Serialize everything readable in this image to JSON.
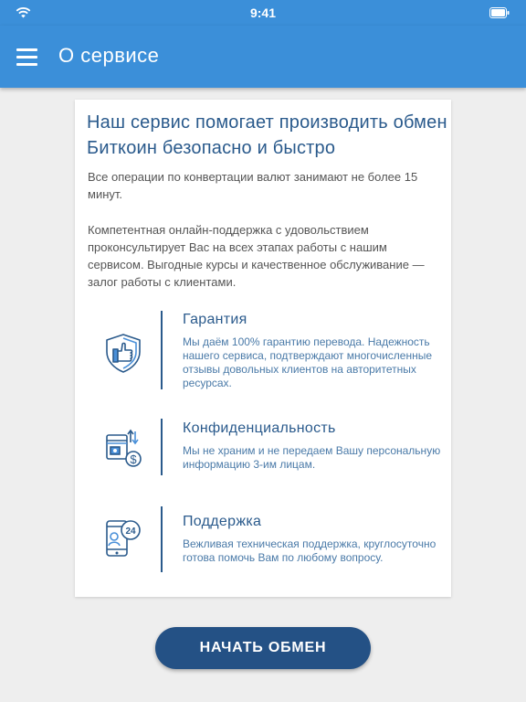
{
  "status_bar": {
    "time": "9:41"
  },
  "app_bar": {
    "title": "О сервисе",
    "menu_icon": "hamburger-menu-icon"
  },
  "card": {
    "headline": "Наш сервис помогает производить обмен Биткоин безопасно и быстро",
    "paragraph_1": "Все операции по конвертации валют занимают не более 15 минут.",
    "paragraph_2": "Компетентная онлайн-поддержка с удовольствием проконсультирует Вас на всех этапах работы с нашим сервисом. Выгодные курсы и качественное обслуживание — залог работы с клиентами.",
    "features": [
      {
        "title": "Гарантия",
        "description": "Мы даём 100% гарантию перевода. Надежность нашего сервиса, подтверждают многочисленные отзывы довольных клиентов на авторитетных ресурсах.",
        "icon": "shield-thumbs-up-icon"
      },
      {
        "title": "Конфиденциальность",
        "description": "Мы не храним и не передаем Вашу персональную информацию 3-им лицам.",
        "icon": "secure-payment-icon"
      },
      {
        "title": "Поддержка",
        "description": "Вежливая техническая поддержка, круглосуточно готова помочь Вам по любому вопросу.",
        "icon": "phone-support-24-icon"
      }
    ]
  },
  "cta_button": {
    "label": "НАЧАТЬ ОБМЕН"
  },
  "colors": {
    "app_bar": "#3b8fd9",
    "accent": "#2a5a8c",
    "button": "#245185",
    "background": "#eeeeee"
  }
}
